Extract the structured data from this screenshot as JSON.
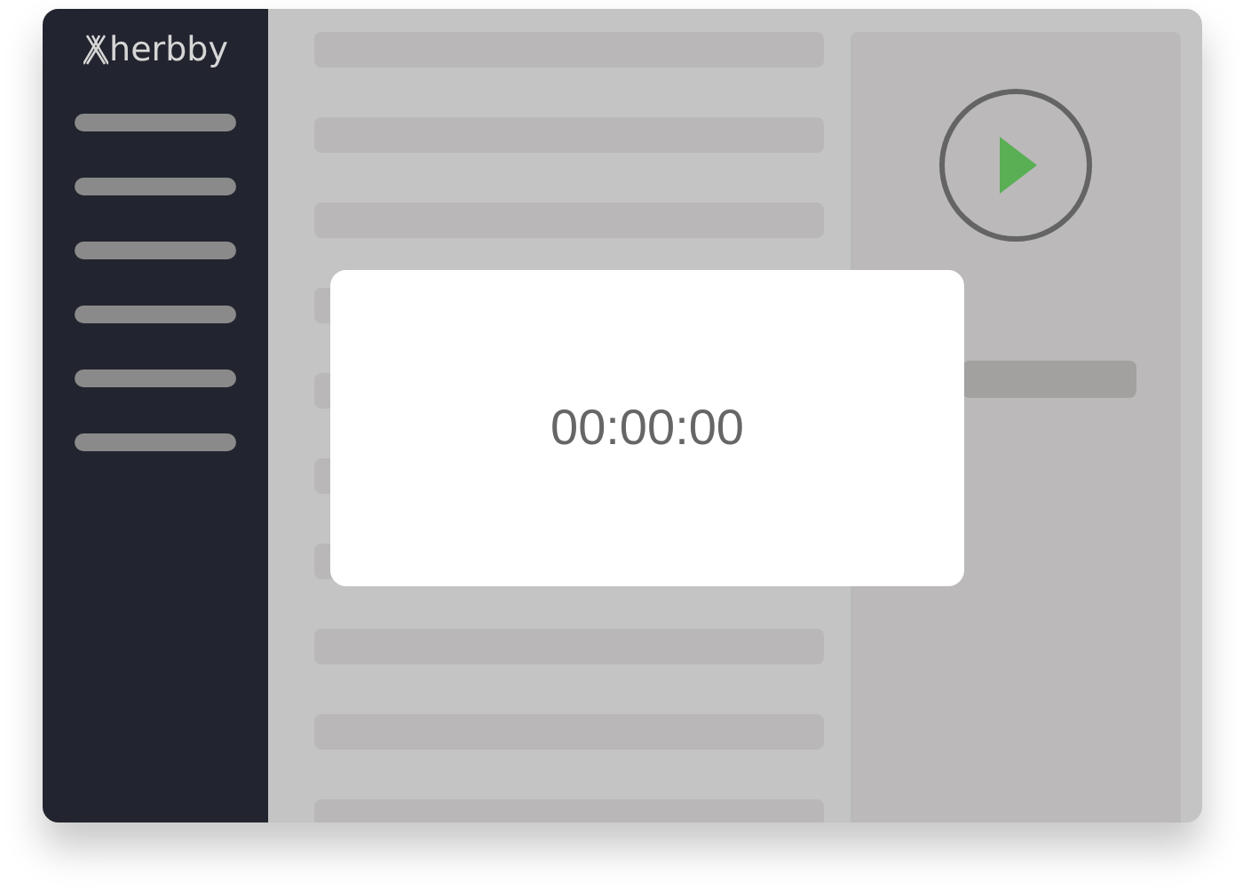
{
  "logo": {
    "text": "herbby"
  },
  "timer": {
    "time": "00:00:00"
  }
}
